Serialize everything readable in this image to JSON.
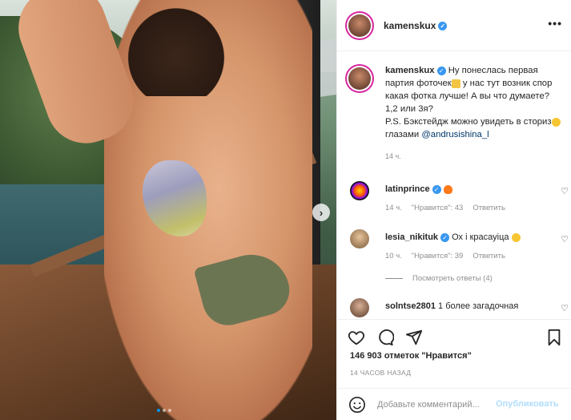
{
  "colors": {
    "accent": "#0095f6",
    "verified": "#3897f0",
    "link": "#00376b",
    "muted": "#8e8e8e"
  },
  "post": {
    "author": "kamenskux",
    "caption_parts": {
      "part1": "Ну понеслась первая партия фоточек",
      "part2": " у нас тут возник спор какая фотка лучше! А вы что думаете? 1,2 или 3я?",
      "part3": "P.S. Бэкстейдж можно увидеть в сториз",
      "part4": " глазами ",
      "mention": "@andrusishina_l"
    },
    "caption_time": "14 ч.",
    "likes": "146 903 отметок \"Нравится\"",
    "posted": "14 ЧАСОВ НАЗАД",
    "carousel": {
      "total": 3,
      "active": 1
    }
  },
  "comments": [
    {
      "user": "latinprince",
      "verified": true,
      "text": "",
      "time": "14 ч.",
      "likes": "\"Нравится\": 43",
      "reply": "Ответить"
    },
    {
      "user": "lesia_nikituk",
      "verified": true,
      "text": "Ох і красауіца",
      "time": "10 ч.",
      "likes": "\"Нравится\": 39",
      "reply": "Ответить"
    },
    {
      "user": "solntse2801",
      "verified": false,
      "text": "1 более загадочная"
    }
  ],
  "view_replies": "Посмотреть ответы (4)",
  "composer": {
    "placeholder": "Добавьте комментарий...",
    "publish": "Опубликовать"
  },
  "icons": {
    "more": "more-icon",
    "heart": "heart-icon",
    "comment": "comment-icon",
    "share": "share-icon",
    "save": "bookmark-icon",
    "emoji": "smile-icon",
    "next": "chevron-right-icon"
  }
}
